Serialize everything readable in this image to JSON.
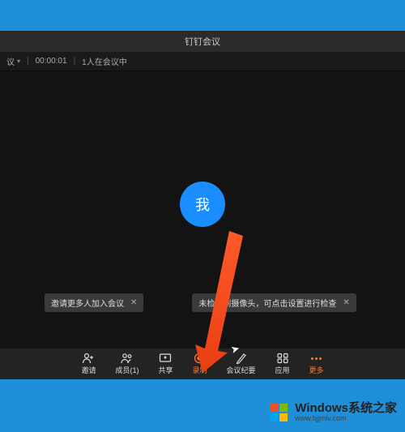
{
  "window": {
    "title": "钉钉会议"
  },
  "infobar": {
    "meeting_label": "议",
    "timer": "00:00:01",
    "participants": "1人在会议中"
  },
  "avatar": {
    "label": "我"
  },
  "toasts": {
    "invite": {
      "text": "邀请更多人加入会议",
      "close": "✕"
    },
    "camera": {
      "text": "未检测到摄像头，可点击设置进行检查",
      "close": "✕"
    }
  },
  "toolbar": {
    "invite": "邀请",
    "members": "成员(1)",
    "share": "共享",
    "record": "录制",
    "notes": "会议纪要",
    "apps": "应用",
    "more": "更多"
  },
  "watermark": {
    "main": "Windows系统之家",
    "sub": "www.bjjmlv.com"
  }
}
